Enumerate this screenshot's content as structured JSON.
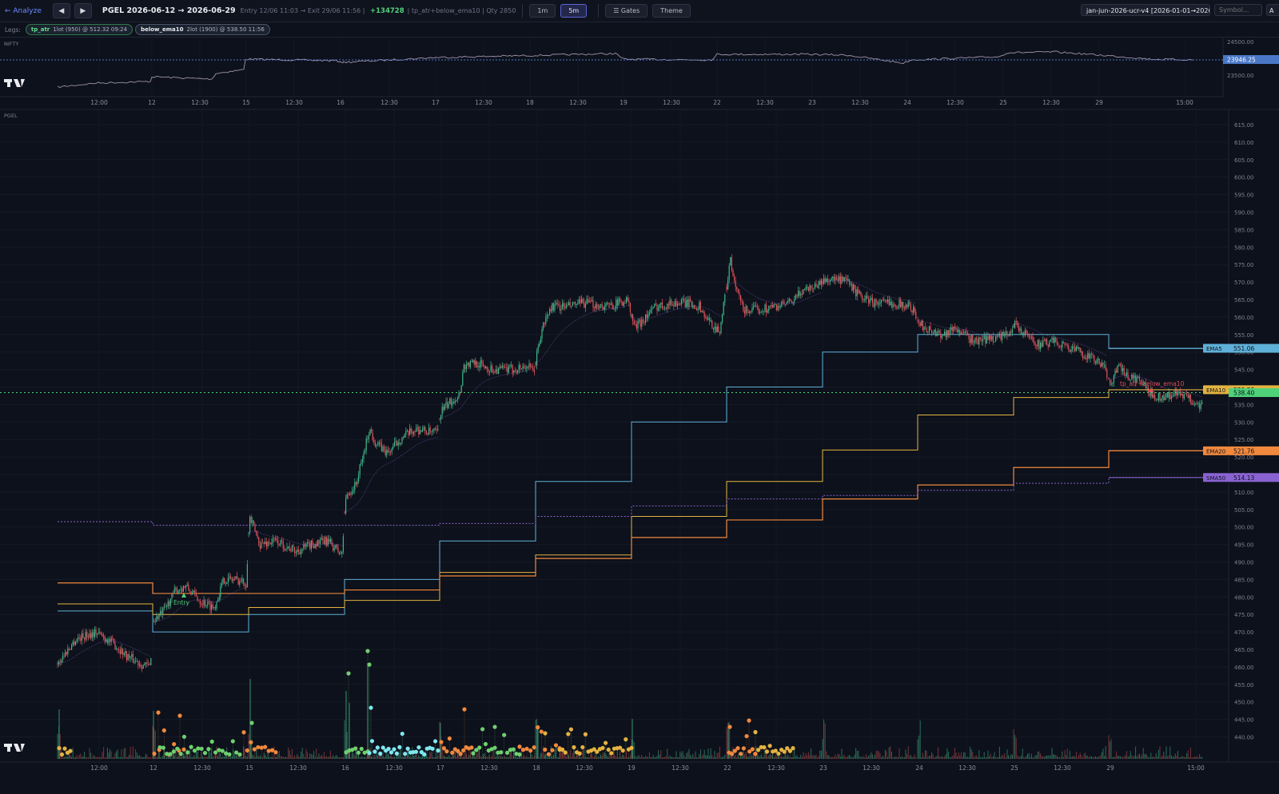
{
  "toolbar": {
    "back": "← Analyze",
    "prev": "◀",
    "next": "▶",
    "title": "PGEL 2026-06-12 → 2026-06-29",
    "entry_exit": "Entry 12/06 11:03 → Exit 29/06 11:56",
    "pnl": "+134728",
    "rule": "tp_atr+below_ema10",
    "qty": "Qty 2850",
    "tf_1m": "1m",
    "tf_5m": "5m",
    "gates": "☰ Gates",
    "theme": "Theme",
    "preset": "jan-jun-2026-ucr-v4 [2026-01-01→2026-06-",
    "symbol_placeholder": "Symbol...",
    "a_button": "A"
  },
  "legs": {
    "label": "Legs:",
    "items": [
      {
        "name": "tp_atr",
        "detail": "1lot (950) @ 512.32 09:24"
      },
      {
        "name": "below_ema10",
        "detail": "2lot (1900) @ 538.50 11:56"
      }
    ]
  },
  "nifty": {
    "label": "NIFTY",
    "last": "23946.25",
    "y_ticks": [
      "24500.00",
      "23500.00"
    ],
    "x_ticks": [
      "12:00",
      "12",
      "12:30",
      "15",
      "12:30",
      "16",
      "12:30",
      "17",
      "12:30",
      "18",
      "12:30",
      "19",
      "12:30",
      "22",
      "12:30",
      "23",
      "12:30",
      "24",
      "12:30",
      "25",
      "12:30",
      "29",
      "15:00"
    ]
  },
  "main": {
    "label": "PGEL",
    "y_ticks": [
      "615.00",
      "610.00",
      "605.00",
      "600.00",
      "595.00",
      "590.00",
      "585.00",
      "580.00",
      "575.00",
      "570.00",
      "565.00",
      "560.00",
      "555.00",
      "550.00",
      "545.00",
      "540.00",
      "535.00",
      "530.00",
      "525.00",
      "520.00",
      "515.00",
      "510.00",
      "505.00",
      "500.00",
      "495.00",
      "490.00",
      "485.00",
      "480.00",
      "475.00",
      "470.00",
      "465.00",
      "460.00",
      "455.00",
      "450.00",
      "445.00",
      "440.00"
    ],
    "x_ticks": [
      "12:00",
      "12",
      "12:30",
      "15",
      "12:30",
      "16",
      "12:30",
      "17",
      "12:30",
      "18",
      "12:30",
      "19",
      "12:30",
      "22",
      "12:30",
      "23",
      "12:30",
      "24",
      "12:30",
      "25",
      "12:30",
      "29",
      "15:00"
    ],
    "entry_marker": "Entry",
    "exit_marker": "tp_atr+below_ema10",
    "price_label": "538.40",
    "legend": [
      {
        "name": "EMA5",
        "value": "551.06",
        "color": "#5fb0d8"
      },
      {
        "name": "EMA10",
        "value": "539.23",
        "color": "#e3b341"
      },
      {
        "name": "EMA20",
        "value": "521.76",
        "color": "#f0883e"
      },
      {
        "name": "SMA50",
        "value": "514.13",
        "color": "#8a63d2"
      }
    ]
  },
  "colors": {
    "bg": "#0d111b",
    "up": "#3fb68b",
    "down": "#e0515b",
    "ema5": "#5fb0d8",
    "ema10": "#e3b341",
    "ema20": "#f0883e",
    "sma50": "#8a63d2",
    "price": "#4fd17a"
  },
  "icons": {
    "logo": "tradingview-logo-icon"
  }
}
